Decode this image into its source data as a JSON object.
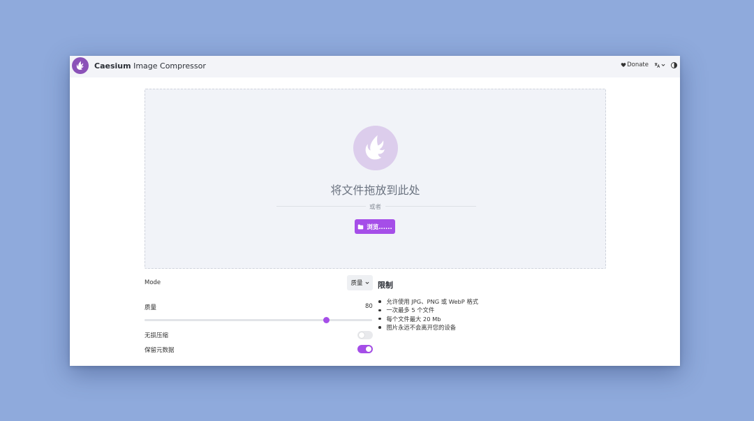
{
  "app": {
    "brand_bold": "Caesium",
    "brand_rest": " Image Compressor",
    "logo_icon": "caesium-bird-icon"
  },
  "header": {
    "donate_label": "Donate",
    "donate_icon": "heart-icon",
    "language_icon": "translate-icon",
    "theme_icon": "contrast-icon"
  },
  "dropzone": {
    "title": "将文件拖放到此处",
    "or_text": "或者",
    "browse_label": "浏览......",
    "browse_icon": "folder-icon"
  },
  "settings": {
    "mode_label": "Mode",
    "mode_value": "质量",
    "quality_label": "质量",
    "quality_value": "80",
    "quality_percent": 80,
    "lossless_label": "无损压缩",
    "lossless_on": false,
    "keep_metadata_label": "保留元数据",
    "keep_metadata_on": true
  },
  "limits": {
    "title": "限制",
    "items": [
      "允许使用 JPG、PNG 或 WebP 格式",
      "一次最多 5 个文件",
      "每个文件最大 20 Mb",
      "图片永远不会离开您的设备"
    ]
  },
  "colors": {
    "accent": "#a54ee8",
    "logo_bg": "#8b52b8",
    "page_bg": "#8faadc"
  }
}
